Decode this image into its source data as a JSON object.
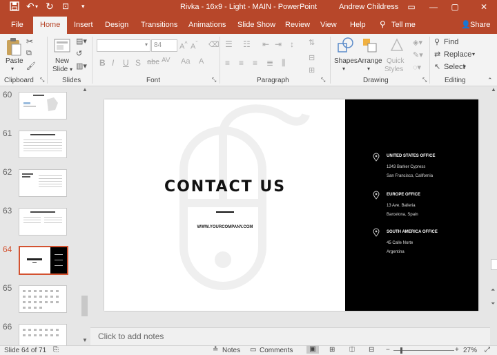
{
  "window": {
    "title": "Rivka - 16x9 - Light - MAIN  -  PowerPoint",
    "user": "Andrew Childress"
  },
  "tabs": [
    "File",
    "Home",
    "Insert",
    "Design",
    "Transitions",
    "Animations",
    "Slide Show",
    "Review",
    "View",
    "Help"
  ],
  "tell_me": "Tell me",
  "share": "Share",
  "ribbon": {
    "clipboard": {
      "label": "Clipboard",
      "paste": "Paste"
    },
    "slides": {
      "label": "Slides",
      "new_slide_1": "New",
      "new_slide_2": "Slide"
    },
    "font": {
      "label": "Font",
      "font_name": "",
      "font_size": "84"
    },
    "paragraph": {
      "label": "Paragraph"
    },
    "drawing": {
      "label": "Drawing",
      "shapes": "Shapes",
      "arrange": "Arrange",
      "quick_styles_1": "Quick",
      "quick_styles_2": "Styles"
    },
    "editing": {
      "label": "Editing",
      "find": "Find",
      "replace": "Replace",
      "select": "Select"
    }
  },
  "thumbnails": [
    {
      "num": "60",
      "selected": false
    },
    {
      "num": "61",
      "selected": false
    },
    {
      "num": "62",
      "selected": false
    },
    {
      "num": "63",
      "selected": false
    },
    {
      "num": "64",
      "selected": true
    },
    {
      "num": "65",
      "selected": false
    },
    {
      "num": "66",
      "selected": false
    }
  ],
  "slide": {
    "heading": "CONTACT US",
    "website": "WWW.YOURCOMPANY.COM",
    "offices": [
      {
        "name": "UNITED STATES OFFICE",
        "line1": "1243 Barker Cypress",
        "line2": "San Francisco, California"
      },
      {
        "name": "EUROPE OFFICE",
        "line1": "13 Ave. Balleria",
        "line2": "Barcelona, Spain"
      },
      {
        "name": "SOUTH AMERICA OFFICE",
        "line1": "45 Calle Norte",
        "line2": "Argentina"
      }
    ]
  },
  "notes_placeholder": "Click to add notes",
  "status": {
    "slide_counter": "Slide 64 of 71",
    "notes": "Notes",
    "comments": "Comments",
    "zoom": "27%"
  },
  "colors": {
    "accent": "#b7472a",
    "selected_thumb": "#d35230"
  }
}
